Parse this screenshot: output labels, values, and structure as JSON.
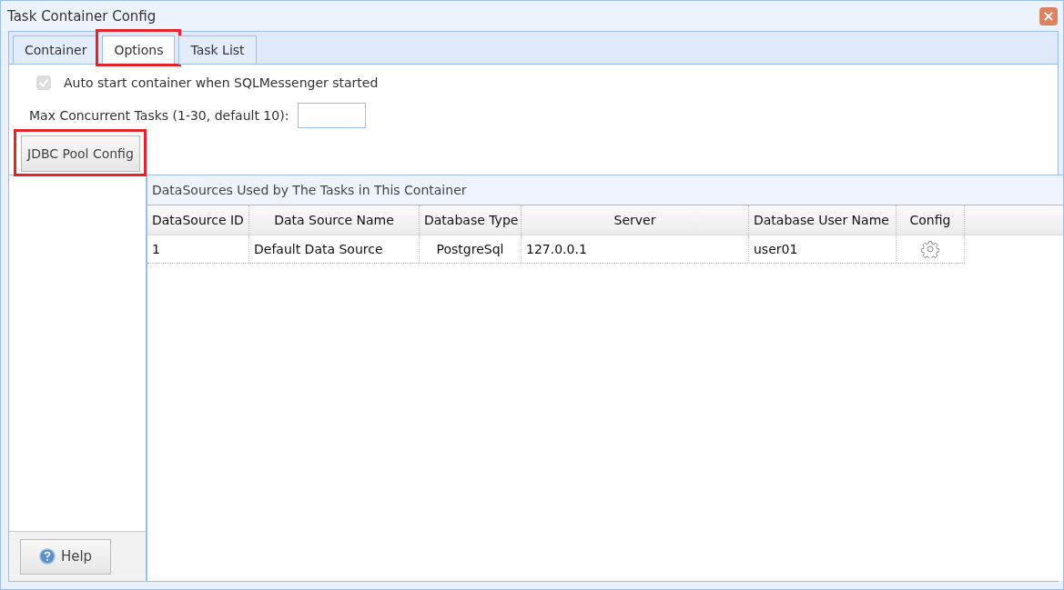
{
  "window": {
    "title": "Task Container Config",
    "close": "×"
  },
  "tabs": [
    {
      "label": "Container",
      "selected": false,
      "highlighted": false
    },
    {
      "label": "Options",
      "selected": true,
      "highlighted": true
    },
    {
      "label": "Task List",
      "selected": false,
      "highlighted": false
    }
  ],
  "options": {
    "auto_start": {
      "label": "Auto start container when SQLMessenger started",
      "checked": true,
      "disabled": true
    },
    "max_tasks": {
      "label": "Max Concurrent Tasks (1-30, default 10):"
    },
    "jdbc_button": {
      "label": "JDBC Pool Config",
      "highlighted": true
    }
  },
  "help_button": {
    "label": "Help"
  },
  "datasources": {
    "title": "DataSources Used by The Tasks in This Container",
    "columns": [
      "DataSource ID",
      "Data Source Name",
      "Database Type",
      "Server",
      "Database User Name",
      "Config"
    ],
    "rows": [
      {
        "cells": [
          "1",
          "Default Data Source",
          "PostgreSql",
          "127.0.0.1",
          "user01"
        ]
      }
    ]
  }
}
